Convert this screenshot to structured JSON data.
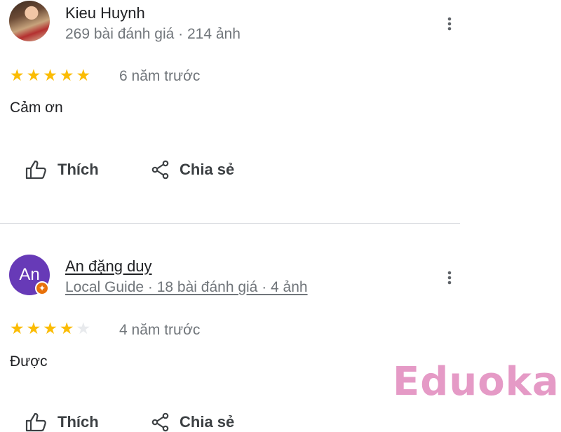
{
  "reviews": [
    {
      "author": "Kieu Huynh",
      "meta": "269 bài đánh giá · 214 ảnh",
      "rating": 5,
      "time": "6 năm trước",
      "text": "Cảm ơn",
      "like_label": "Thích",
      "share_label": "Chia sẻ"
    },
    {
      "author": "An đặng duy",
      "avatar_letter": "An",
      "meta": "Local Guide · 18 bài đánh giá · 4 ảnh",
      "rating": 4,
      "time": "4 năm trước",
      "text": "Được",
      "like_label": "Thích",
      "share_label": "Chia sẻ"
    }
  ],
  "watermark": "Eduoka",
  "colors": {
    "star": "#fbbc04",
    "avatar_bg": "#673ab7",
    "badge": "#e8710a",
    "watermark": "#e59ac6"
  },
  "icons": [
    "more-vert-icon",
    "thumb-up-icon",
    "share-icon",
    "local-guide-badge-icon"
  ]
}
